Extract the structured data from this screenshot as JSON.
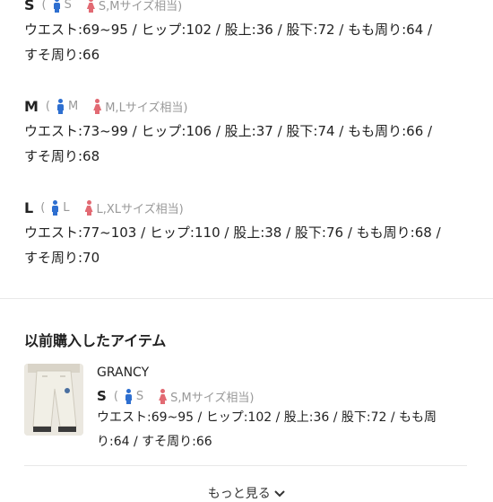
{
  "sizes": [
    {
      "letter": "S",
      "paren": "(",
      "male_size": "S",
      "female_size": "S,Mサイズ相当)",
      "line1": "ウエスト:69~95 / ヒップ:102 / 股上:36 / 股下:72 / もも周り:64 /",
      "line2": "すそ周り:66"
    },
    {
      "letter": "M",
      "paren": "(",
      "male_size": "M",
      "female_size": "M,Lサイズ相当)",
      "line1": "ウエスト:73~99 / ヒップ:106 / 股上:37 / 股下:74 / もも周り:66 /",
      "line2": "すそ周り:68"
    },
    {
      "letter": "L",
      "paren": "(",
      "male_size": "L",
      "female_size": "L,XLサイズ相当)",
      "line1": "ウエスト:77~103 / ヒップ:110 / 股上:38 / 股下:76 / もも周り:68 /",
      "line2": "すそ周り:70"
    }
  ],
  "previous": {
    "title": "以前購入したアイテム",
    "brand": "GRANCY",
    "letter": "S",
    "paren": "(",
    "male_size": "S",
    "female_size": "S,Mサイズ相当)",
    "line1": "ウエスト:69~95 / ヒップ:102 / 股上:36 / 股下:72 / もも周",
    "line2": "り:64 / すそ周り:66"
  },
  "more_label": "もっと見る",
  "icons": {
    "male": "male-figure-icon",
    "female": "female-figure-icon",
    "chevron": "chevron-down-icon"
  },
  "colors": {
    "male_icon": "#2e6fd0",
    "female_icon": "#e26a73",
    "muted_text": "#999999"
  }
}
